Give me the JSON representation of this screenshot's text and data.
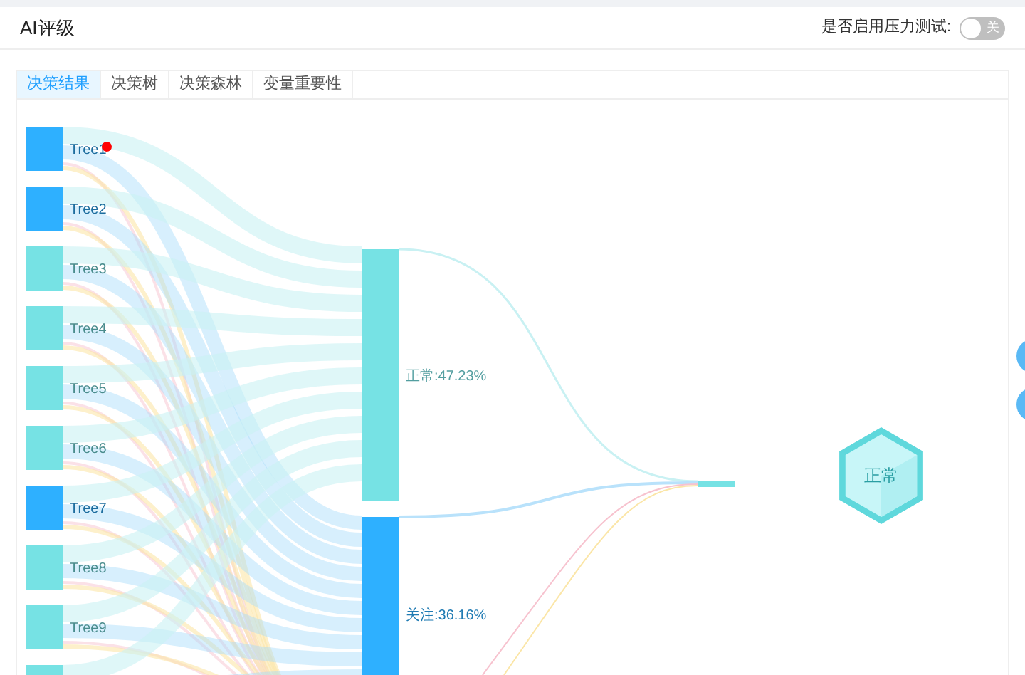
{
  "header": {
    "title": "AI评级",
    "stress_test": {
      "label": "是否启用压力测试:",
      "switch_text": "关",
      "on": false
    }
  },
  "tabs": [
    {
      "label": "决策结果",
      "selected": true
    },
    {
      "label": "决策树",
      "selected": false
    },
    {
      "label": "决策森林",
      "selected": false
    },
    {
      "label": "变量重要性",
      "selected": false
    }
  ],
  "sankey": {
    "sources": [
      {
        "label": "Tree1",
        "color": "#2eb0ff",
        "flagged": true
      },
      {
        "label": "Tree2",
        "color": "#2eb0ff",
        "flagged": false
      },
      {
        "label": "Tree3",
        "color": "#76e2e4",
        "flagged": false
      },
      {
        "label": "Tree4",
        "color": "#76e2e4",
        "flagged": false
      },
      {
        "label": "Tree5",
        "color": "#76e2e4",
        "flagged": false
      },
      {
        "label": "Tree6",
        "color": "#76e2e4",
        "flagged": false
      },
      {
        "label": "Tree7",
        "color": "#2eb0ff",
        "flagged": false
      },
      {
        "label": "Tree8",
        "color": "#76e2e4",
        "flagged": false
      },
      {
        "label": "Tree9",
        "color": "#76e2e4",
        "flagged": false
      },
      {
        "color": "#76e2e4",
        "flagged": false
      }
    ],
    "targets": [
      {
        "label": "正常:47.23%",
        "color": "#76e2e4"
      },
      {
        "label": "关注:36.16%",
        "color": "#2eb0ff"
      }
    ],
    "result": {
      "label": "正常"
    }
  }
}
